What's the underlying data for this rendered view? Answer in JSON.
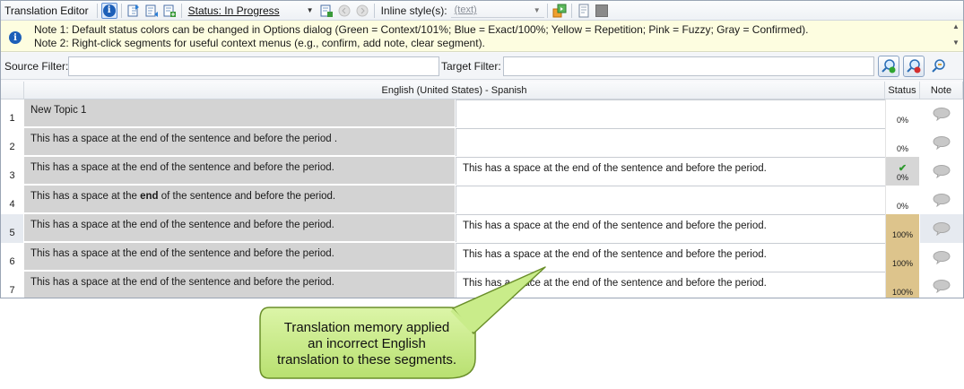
{
  "toolbar": {
    "title": "Translation Editor",
    "status_value": "Status: In Progress",
    "inline_label": "Inline style(s):",
    "inline_placeholder": "(text)"
  },
  "notes": {
    "note1": "Note 1: Default status colors can be changed in Options dialog (Green = Context/101%; Blue = Exact/100%; Yellow = Repetition; Pink = Fuzzy; Gray = Confirmed).",
    "note2": "Note 2: Right-click segments for useful context menus (e.g., confirm, add note, clear segment)."
  },
  "filters": {
    "source_label": "Source Filter:",
    "target_label": "Target Filter:"
  },
  "grid": {
    "header_language": "English (United States) - Spanish",
    "header_status": "Status",
    "header_note": "Note",
    "rows": [
      {
        "num": "1",
        "src_pre": "New Topic 1",
        "src_bold": "",
        "src_post": "",
        "tgt": "",
        "status": "0%",
        "check": ""
      },
      {
        "num": "2",
        "src_pre": "This has a space at the end of the sentence and before the period .",
        "src_bold": "",
        "src_post": "",
        "tgt": "",
        "status": "0%",
        "check": ""
      },
      {
        "num": "3",
        "src_pre": "This has a space at the end of the sentence and before the period.",
        "src_bold": "",
        "src_post": "",
        "tgt": "This has a space at the end of the sentence and before the period.",
        "status": "0%",
        "check": "✔"
      },
      {
        "num": "4",
        "src_pre": "This has a space at the ",
        "src_bold": "end",
        "src_post": " of the sentence and before the period.",
        "tgt": "",
        "status": "0%",
        "check": ""
      },
      {
        "num": "5",
        "src_pre": "This has a space at the end of the sentence and before the period.",
        "src_bold": "",
        "src_post": "",
        "tgt": "This has a space at the end of the sentence and before the period.",
        "status": "100%",
        "check": ""
      },
      {
        "num": "6",
        "src_pre": "This has a space at the end of the sentence and before the period.",
        "src_bold": "",
        "src_post": "",
        "tgt": "This has a space at the end of the sentence and before the period.",
        "status": "100%",
        "check": ""
      },
      {
        "num": "7",
        "src_pre": "This has a space at the end of the sentence and before the period.",
        "src_bold": "",
        "src_post": "",
        "tgt": "This has a space at the end of the sentence and before the period.",
        "status": "100%",
        "check": ""
      }
    ]
  },
  "callout": {
    "line1": "Translation memory applied",
    "line2": "an incorrect English",
    "line3": "translation to these segments."
  },
  "colors": {
    "source_bg": "#d3d3d3",
    "exact_status": "#ddc48c",
    "confirmed_status": "#d6d6d6",
    "callout_fill": "#c9ec8a",
    "notes_bg": "#fdfde0"
  },
  "icons": [
    "info-icon",
    "import-icon",
    "export-icon",
    "add-segment-icon",
    "filter-green-icon",
    "filter-red-icon",
    "search-icon",
    "comment-icon"
  ]
}
